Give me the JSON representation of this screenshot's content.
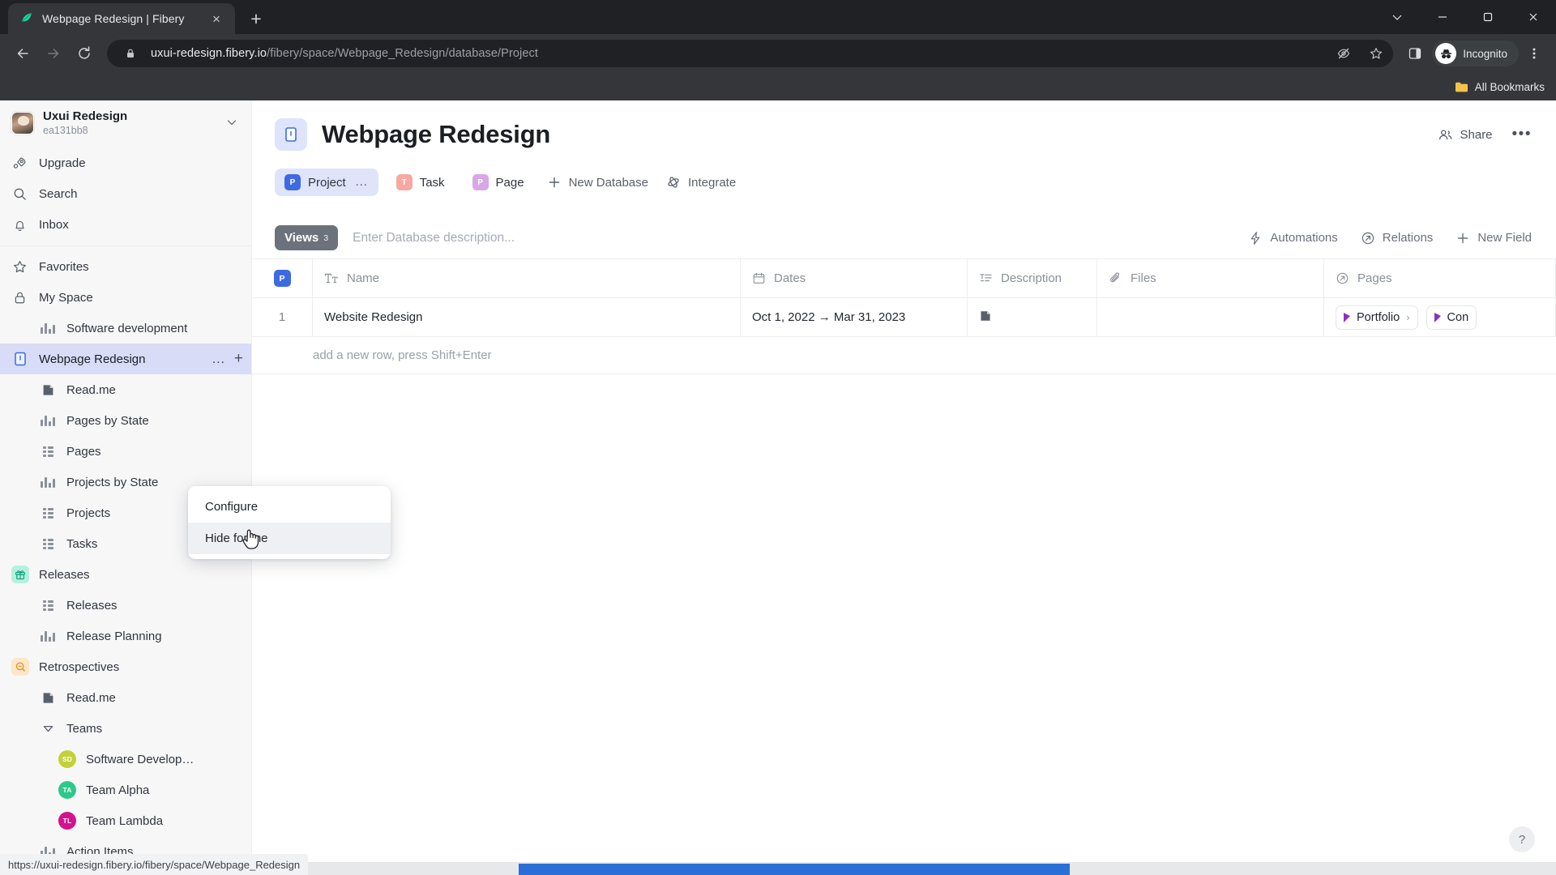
{
  "browser": {
    "tab": {
      "title": "Webpage Redesign | Fibery",
      "favicon": "fibery-leaf-icon",
      "close": "×"
    },
    "new_tab_label": "+",
    "window_controls": {
      "minimize": "−",
      "maximize": "□",
      "close": "✕",
      "chevron": "⌄"
    },
    "nav": {
      "back": "←",
      "forward": "→",
      "reload": "⟳"
    },
    "omnibox": {
      "lock_icon": "lock-icon",
      "url_host": "uxui-redesign.fibery.io",
      "url_path": "/fibery/space/Webpage_Redesign/database/Project",
      "tracking_icon": "eye-off-icon",
      "bookmark_icon": "star-icon"
    },
    "side_panel_icon": "side-panel-icon",
    "profile": {
      "label": "Incognito",
      "icon": "incognito-icon"
    },
    "menu_icon": "kebab-menu-icon",
    "bookmarks_bar": {
      "label": "All Bookmarks",
      "icon": "folder-icon"
    }
  },
  "status_bar": {
    "url": "https://uxui-redesign.fibery.io/fibery/space/Webpage_Redesign"
  },
  "sidebar": {
    "workspace": {
      "name": "Uxui Redesign",
      "id": "ea131bb8",
      "chevron": "chevron-down-icon"
    },
    "nav": [
      {
        "label": "Upgrade",
        "icon": "rocket-icon"
      },
      {
        "label": "Search",
        "icon": "search-icon"
      },
      {
        "label": "Inbox",
        "icon": "bell-icon"
      }
    ],
    "sections": [
      {
        "label": "Favorites",
        "icon": "star-icon"
      },
      {
        "label": "My Space",
        "icon": "lock-icon"
      }
    ],
    "tree": [
      {
        "label": "Software development",
        "level": 1,
        "icon": "chart-view-icon"
      },
      {
        "label": "Webpage Redesign",
        "level": 0,
        "icon": "space-webpage-icon",
        "active": true,
        "actions": [
          "…",
          "+"
        ]
      },
      {
        "label": "Read.me",
        "level": 1,
        "icon": "document-icon"
      },
      {
        "label": "Pages by State",
        "level": 1,
        "icon": "chart-view-icon"
      },
      {
        "label": "Pages",
        "level": 1,
        "icon": "grid-view-icon"
      },
      {
        "label": "Projects by State",
        "level": 1,
        "icon": "chart-view-icon"
      },
      {
        "label": "Projects",
        "level": 1,
        "icon": "grid-view-icon"
      },
      {
        "label": "Tasks",
        "level": 1,
        "icon": "grid-view-icon"
      },
      {
        "label": "Releases",
        "level": 0,
        "icon": "gift-icon",
        "badge_bg": "#b5f0de"
      },
      {
        "label": "Releases",
        "level": 1,
        "icon": "grid-view-icon"
      },
      {
        "label": "Release Planning",
        "level": 1,
        "icon": "chart-view-icon"
      },
      {
        "label": "Retrospectives",
        "level": 0,
        "icon": "retro-icon",
        "badge_bg": "#fde7c8"
      },
      {
        "label": "Read.me",
        "level": 1,
        "icon": "document-icon"
      },
      {
        "label": "Teams",
        "level": 1,
        "icon": "chevron-collapse-icon"
      },
      {
        "label": "Software Develop…",
        "level": 2,
        "icon": "avatar",
        "initials": "SD",
        "color": "#c3d136"
      },
      {
        "label": "Team Alpha",
        "level": 2,
        "icon": "avatar",
        "initials": "TA",
        "color": "#2dc98a"
      },
      {
        "label": "Team Lambda",
        "level": 2,
        "icon": "avatar",
        "initials": "TL",
        "color": "#d4118f"
      },
      {
        "label": "Action Items",
        "level": 1,
        "icon": "chart-view-icon"
      }
    ]
  },
  "header": {
    "title": "Webpage Redesign",
    "icon": "database-icon",
    "share_label": "Share",
    "share_icon": "people-icon",
    "more_icon": "ellipsis-icon"
  },
  "db_tabs": [
    {
      "label": "Project",
      "initial": "P",
      "color": "#3e6ae1",
      "bg": "#dfe4fb",
      "active": true,
      "menu": "…"
    },
    {
      "label": "Task",
      "initial": "T",
      "color": "#f6a9a0",
      "bg": "#fff",
      "active": false
    },
    {
      "label": "Page",
      "initial": "P",
      "color": "#d9a6e8",
      "bg": "#fff",
      "active": false
    }
  ],
  "db_actions": [
    {
      "label": "New Database",
      "icon": "plus-icon"
    },
    {
      "label": "Integrate",
      "icon": "integrate-icon"
    }
  ],
  "view_bar": {
    "views_label": "Views",
    "views_count": "3",
    "description_placeholder": "Enter Database description...",
    "actions": [
      {
        "label": "Automations",
        "icon": "bolt-icon"
      },
      {
        "label": "Relations",
        "icon": "arrow-circle-icon"
      },
      {
        "label": "New Field",
        "icon": "plus-icon"
      }
    ]
  },
  "table": {
    "columns": [
      {
        "key": "idx",
        "label": "",
        "icon": "project-badge-icon"
      },
      {
        "key": "name",
        "label": "Name",
        "icon": "text-field-icon"
      },
      {
        "key": "dates",
        "label": "Dates",
        "icon": "calendar-icon"
      },
      {
        "key": "desc",
        "label": "Description",
        "icon": "rich-text-icon"
      },
      {
        "key": "files",
        "label": "Files",
        "icon": "paperclip-icon"
      },
      {
        "key": "pages",
        "label": "Pages",
        "icon": "relation-icon"
      }
    ],
    "rows": [
      {
        "num": "1",
        "name": "Website Redesign",
        "dates": "Oct 1, 2022 → Mar 31, 2023",
        "desc_icon": "document-icon",
        "files": "",
        "pages": [
          {
            "label": "Portfolio",
            "icon": "page-triangle-icon",
            "chevron": "›"
          },
          {
            "label": "Con",
            "icon": "page-triangle-icon",
            "chevron": ""
          }
        ]
      }
    ],
    "add_row_hint": "add a new row, press Shift+Enter"
  },
  "context_menu": {
    "items": [
      {
        "label": "Configure",
        "hover": false
      },
      {
        "label": "Hide for me",
        "hover": true
      }
    ]
  },
  "help": {
    "label": "?"
  }
}
